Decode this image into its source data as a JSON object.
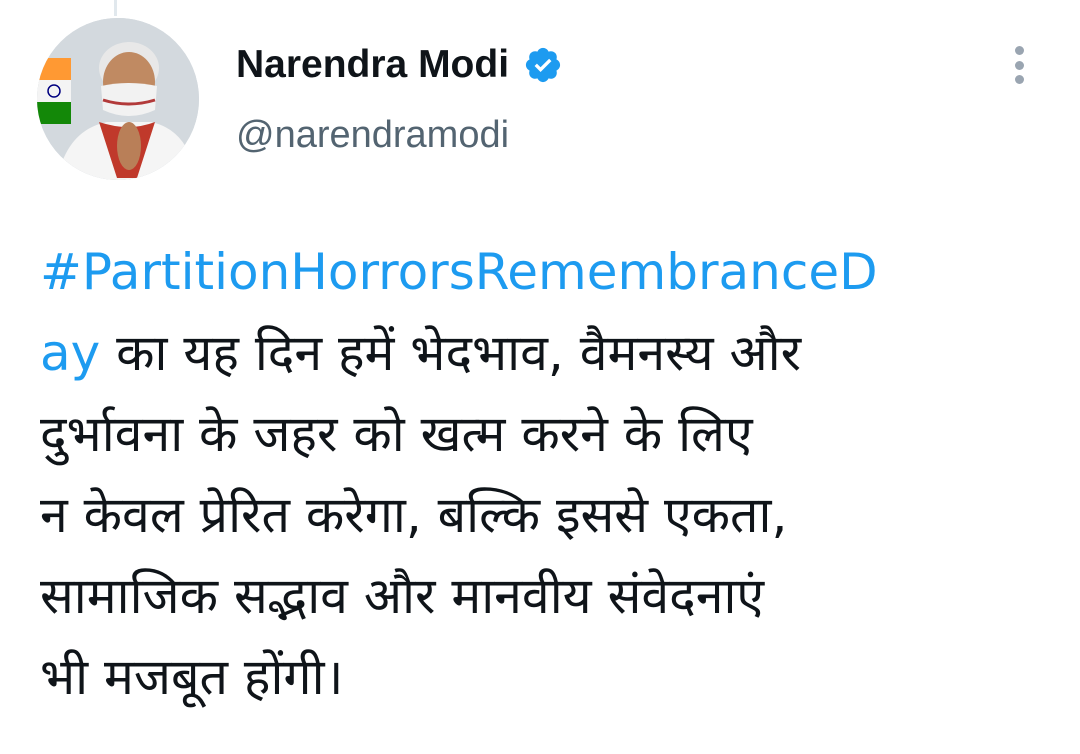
{
  "author": {
    "display_name": "Narendra Modi",
    "handle": "@narendramodi",
    "verified": true,
    "avatar_icon": "profile-photo"
  },
  "menu": {
    "icon": "more-vertical-icon"
  },
  "tweet": {
    "hashtag_part1": "#PartitionHorrorsRemembranceD",
    "hashtag_part2": "ay",
    "line2_rest": " का यह दिन हमें भेदभाव, वैमनस्य और",
    "line3": "दुर्भावना के जहर को खत्म करने के लिए",
    "line4": "न केवल प्रेरित करेगा, बल्कि इससे एकता,",
    "line5": "सामाजिक सद्भाव और मानवीय संवेदनाएं",
    "line6": "भी मजबूत होंगी।"
  },
  "colors": {
    "link": "#1d9bf0",
    "verified_badge": "#1d9bf0",
    "text": "#0f1419",
    "secondary": "#536471"
  }
}
